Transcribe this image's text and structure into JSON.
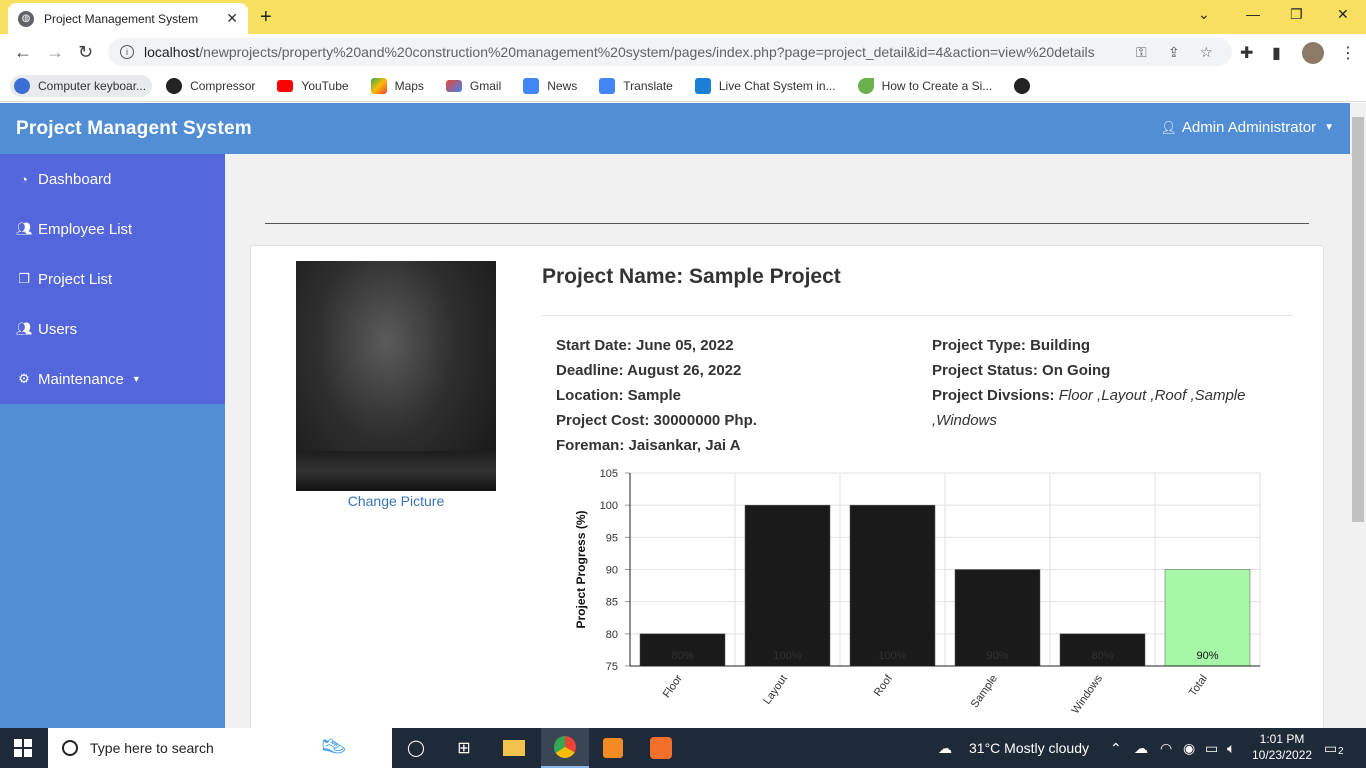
{
  "browser": {
    "tab_title": "Project Management System",
    "url_host": "localhost",
    "url_rest": "/newprojects/property%20and%20construction%20management%20system/pages/index.php?page=project_detail&id=4&action=view%20details",
    "bookmarks": [
      {
        "label": "Computer keyboar...",
        "color": "#3b6fd6"
      },
      {
        "label": "Compressor",
        "color": "#222222"
      },
      {
        "label": "YouTube",
        "color": "#ff0000"
      },
      {
        "label": "Maps",
        "color": "#34a853"
      },
      {
        "label": "Gmail",
        "color": "#ea4335"
      },
      {
        "label": "News",
        "color": "#4285f4"
      },
      {
        "label": "Translate",
        "color": "#4285f4"
      },
      {
        "label": "Live Chat System in...",
        "color": "#1b7fd6"
      },
      {
        "label": "How to Create a Si...",
        "color": "#6ab04c"
      }
    ]
  },
  "app": {
    "brand": "Project Managent System",
    "user": "Admin Administrator",
    "accent": "#528ed6",
    "sidebar_accent": "#5466dc"
  },
  "sidebar": {
    "items": [
      {
        "label": "Dashboard",
        "icon": "dashboard-icon"
      },
      {
        "label": "Employee List",
        "icon": "users-icon"
      },
      {
        "label": "Project List",
        "icon": "clone-icon"
      },
      {
        "label": "Users",
        "icon": "users-icon"
      },
      {
        "label": "Maintenance",
        "icon": "cogs-icon"
      }
    ]
  },
  "project": {
    "change_picture": "Change Picture",
    "title": "Project Name: Sample Project",
    "start_date": "Start Date: June 05, 2022",
    "deadline": "Deadline: August 26, 2022",
    "location": "Location: Sample",
    "cost": "Project Cost: 30000000 Php.",
    "foreman": "Foreman: Jaisankar, Jai A",
    "type": "Project Type: Building",
    "status": "Project Status: On Going",
    "divisions_label": "Project Divsions:",
    "divisions_value_line1": "Floor ,Layout ,Roof ,Sample",
    "divisions_value_line2": ",Windows"
  },
  "chart_data": {
    "type": "bar",
    "ylabel": "Project Progress (%)",
    "ylim": [
      75,
      105
    ],
    "yticks": [
      75,
      80,
      85,
      90,
      95,
      100,
      105
    ],
    "categories": [
      "Floor",
      "Layout",
      "Roof",
      "Sample",
      "Windows",
      "Total"
    ],
    "values": [
      80,
      100,
      100,
      90,
      80,
      90
    ],
    "value_labels": [
      "80%",
      "100%",
      "100%",
      "90%",
      "80%",
      "90%"
    ],
    "colors": [
      "#1a1a1a",
      "#1a1a1a",
      "#1a1a1a",
      "#1a1a1a",
      "#1a1a1a",
      "#a6f7a6"
    ],
    "grid": true
  },
  "taskbar": {
    "search_placeholder": "Type here to search",
    "weather": "31°C  Mostly cloudy",
    "time": "1:01 PM",
    "date": "10/23/2022",
    "notifications": "2"
  }
}
